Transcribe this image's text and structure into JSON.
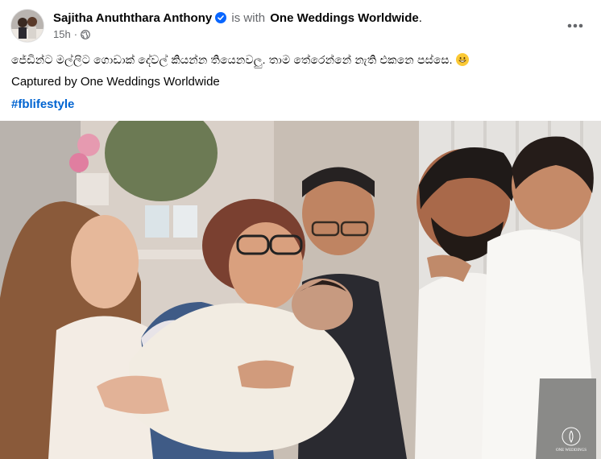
{
  "post": {
    "author_name": "Sajitha Anuththara Anthony",
    "with_text": "is with",
    "tagged_page": "One Weddings Worldwide",
    "tagged_page_suffix": ".",
    "timestamp": "15h",
    "separator": "·",
    "audience_icon": "globe-icon",
    "menu_icon": "more-options-icon",
    "verified_badge": "verified-badge-icon",
    "caption_line_1": "ජේඩින්ට මල්ලිට ගොඩාක් දේවල් කියන්න තියෙනවලු. තාම තේරෙන්නේ නැති එකනෙ පස්සෙ.",
    "caption_emoji": "grinning-face-emoji",
    "caption_line_2": "Captured by One Weddings Worldwide",
    "hashtag": "#fblifestyle"
  },
  "photo": {
    "watermark_text": "ONE WEDDINGS"
  },
  "colors": {
    "link_blue": "#0064d1",
    "verified_blue": "#0866ff",
    "secondary_text": "#65676b",
    "primary_text": "#050505"
  }
}
